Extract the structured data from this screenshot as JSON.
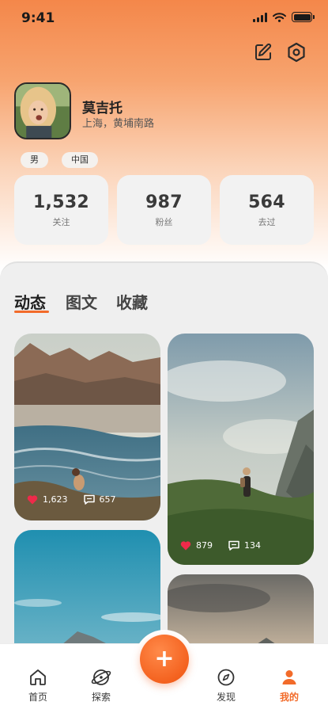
{
  "status_bar": {
    "time": "9:41"
  },
  "profile": {
    "name": "莫吉托",
    "location": "上海，黄埔南路",
    "tags": [
      "男",
      "中国"
    ]
  },
  "stats": [
    {
      "value": "1,532",
      "label": "关注"
    },
    {
      "value": "987",
      "label": "粉丝"
    },
    {
      "value": "564",
      "label": "去过"
    }
  ],
  "tabs": [
    "动态",
    "图文",
    "收藏"
  ],
  "posts": [
    {
      "likes": "1,623",
      "comments": "657"
    },
    {
      "likes": "879",
      "comments": "134"
    }
  ],
  "bottom_nav": {
    "home": "首页",
    "explore": "探索",
    "fab": "+",
    "discover": "发现",
    "mine": "我的"
  },
  "colors": {
    "accent": "#f26b2a",
    "header_top": "#f4874a"
  },
  "icons": [
    "edit-icon",
    "settings-icon",
    "heart-icon",
    "comment-icon",
    "home-icon",
    "explore-icon",
    "compass-icon",
    "user-icon",
    "plus-icon"
  ]
}
